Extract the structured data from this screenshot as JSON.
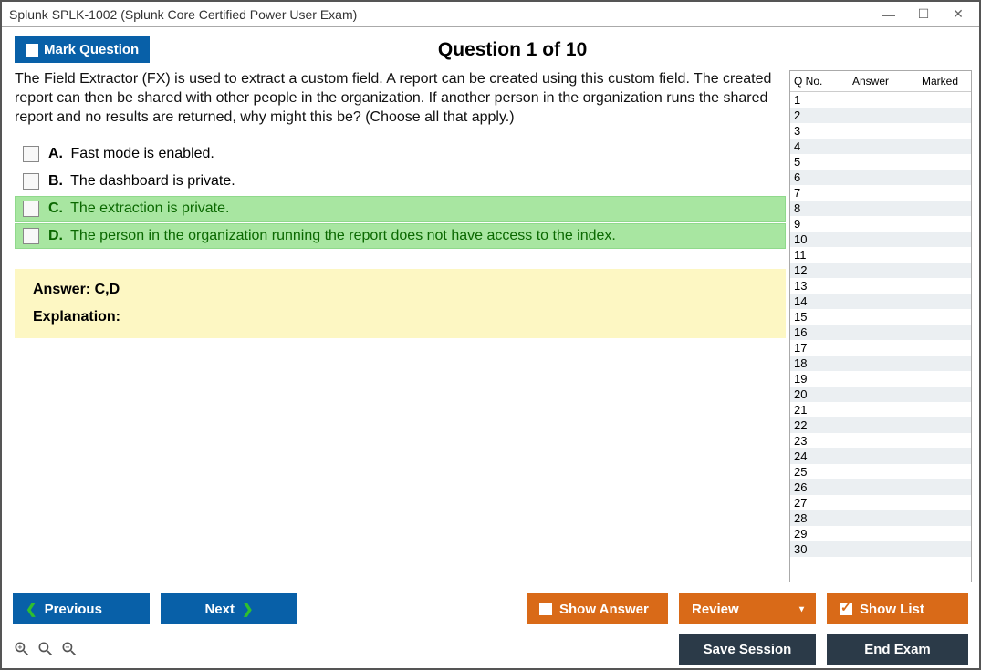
{
  "window": {
    "title": "Splunk SPLK-1002 (Splunk Core Certified Power User Exam)"
  },
  "header": {
    "mark_label": "Mark Question",
    "question_title": "Question 1 of 10"
  },
  "question": {
    "text": "The Field Extractor (FX) is used to extract a custom field. A report can be created using this custom field. The created report can then be shared with other people in the organization. If another person in the organization runs the shared report and no results are returned, why might this be? (Choose all that apply.)",
    "options": [
      {
        "letter": "A.",
        "text": "Fast mode is enabled.",
        "correct": false
      },
      {
        "letter": "B.",
        "text": "The dashboard is private.",
        "correct": false
      },
      {
        "letter": "C.",
        "text": "The extraction is private.",
        "correct": true
      },
      {
        "letter": "D.",
        "text": "The person in the organization running the report does not have access to the index.",
        "correct": true
      }
    ]
  },
  "answer": {
    "line": "Answer: C,D",
    "explanation_label": "Explanation:"
  },
  "sidebar": {
    "headers": {
      "qno": "Q No.",
      "answer": "Answer",
      "marked": "Marked"
    },
    "total_rows": 30
  },
  "footer": {
    "previous": "Previous",
    "next": "Next",
    "show_answer": "Show Answer",
    "review": "Review",
    "show_list": "Show List",
    "save_session": "Save Session",
    "end_exam": "End Exam"
  }
}
